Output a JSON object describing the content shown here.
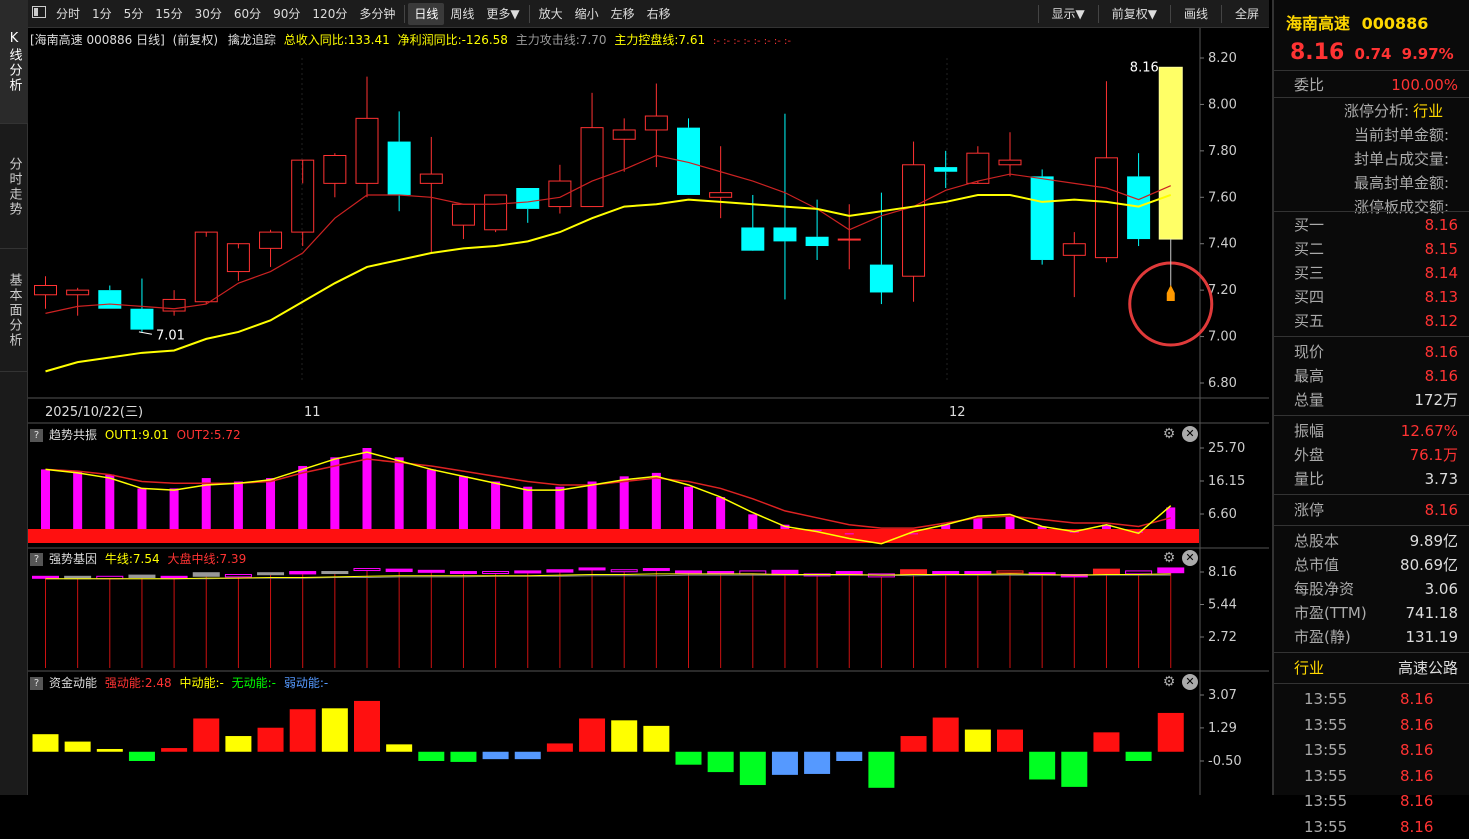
{
  "sidebar": {
    "tabs": [
      {
        "label": "K线分析"
      },
      {
        "label": "分时走势"
      },
      {
        "label": "基本面分析"
      }
    ]
  },
  "toolbar": {
    "left": [
      "分时",
      "1分",
      "5分",
      "15分",
      "30分",
      "60分",
      "90分",
      "120分",
      "多分钟",
      "日线",
      "周线",
      "更多▼",
      "放大",
      "缩小",
      "左移",
      "右移"
    ],
    "selected": "日线",
    "right": [
      "显示▼",
      "前复权▼",
      "画线",
      "全屏"
    ]
  },
  "main": {
    "legend_title": "[海南高速 000886 日线]",
    "legend_adj": "(前复权)",
    "legend_ind": "擒龙追踪",
    "legend_income": "总收入同比:133.41",
    "legend_profit": "净利润同比:-126.58",
    "legend_attack": "主力攻击线:7.70",
    "legend_control": "主力控盘线:7.61",
    "legend_dots": ":- :- :- :- :- :- :- :- ",
    "price_label": "8.16",
    "low_label": "7.01",
    "date_label": "2025/10/22(三)",
    "month_labels": [
      "11",
      "12"
    ],
    "yticks": [
      "8.20",
      "8.00",
      "7.80",
      "7.60",
      "7.40",
      "7.20",
      "7.00",
      "6.80"
    ]
  },
  "panels": [
    {
      "title": "趋势共振",
      "a": "OUT1:9.01",
      "b": "OUT2:5.72",
      "c": "",
      "d": "",
      "yticks": [
        "25.70",
        "16.15",
        "6.60"
      ]
    },
    {
      "title": "强势基因",
      "a": "牛线:7.54",
      "b": "大盘中线:7.39",
      "c": "",
      "d": "",
      "yticks": [
        "8.16",
        "5.44",
        "2.72"
      ]
    },
    {
      "title": "资金动能",
      "a": "强动能:2.48",
      "b": "中动能:-",
      "c": "无动能:-",
      "d": "弱动能:-",
      "yticks": [
        "3.07",
        "1.29",
        "-0.50"
      ]
    }
  ],
  "colors": {
    "up": "#ff3232",
    "down": "#00ffff",
    "ma1": "#ffff00",
    "ma2": "#cc2222",
    "magenta": "#ff00ff"
  },
  "chart_data": {
    "type": "candlestick",
    "candles": [
      [
        7.18,
        7.26,
        7.12,
        7.22
      ],
      [
        7.18,
        7.21,
        7.09,
        7.2
      ],
      [
        7.2,
        7.22,
        7.12,
        7.12
      ],
      [
        7.12,
        7.25,
        7.02,
        7.03
      ],
      [
        7.11,
        7.2,
        7.09,
        7.16
      ],
      [
        7.15,
        7.43,
        7.14,
        7.45
      ],
      [
        7.28,
        7.38,
        7.24,
        7.4
      ],
      [
        7.38,
        7.46,
        7.3,
        7.45
      ],
      [
        7.45,
        7.66,
        7.39,
        7.76
      ],
      [
        7.66,
        7.79,
        7.6,
        7.78
      ],
      [
        7.66,
        8.12,
        7.6,
        7.94
      ],
      [
        7.84,
        7.97,
        7.54,
        7.61
      ],
      [
        7.66,
        7.86,
        7.36,
        7.7
      ],
      [
        7.48,
        7.57,
        7.42,
        7.57
      ],
      [
        7.46,
        7.61,
        7.45,
        7.61
      ],
      [
        7.64,
        7.6,
        7.49,
        7.55
      ],
      [
        7.56,
        7.74,
        7.53,
        7.67
      ],
      [
        7.56,
        8.05,
        7.56,
        7.9
      ],
      [
        7.85,
        7.94,
        7.71,
        7.89
      ],
      [
        7.89,
        8.09,
        7.73,
        7.95
      ],
      [
        7.9,
        7.94,
        7.63,
        7.61
      ],
      [
        7.6,
        7.82,
        7.51,
        7.62
      ],
      [
        7.47,
        7.61,
        7.43,
        7.37
      ],
      [
        7.47,
        7.96,
        7.16,
        7.41
      ],
      [
        7.43,
        7.59,
        7.33,
        7.39
      ],
      [
        7.42,
        7.57,
        7.29,
        7.42
      ],
      [
        7.31,
        7.62,
        7.14,
        7.19
      ],
      [
        7.26,
        7.84,
        7.15,
        7.74
      ],
      [
        7.73,
        7.8,
        7.64,
        7.71
      ],
      [
        7.66,
        7.82,
        7.67,
        7.79
      ],
      [
        7.74,
        7.88,
        7.69,
        7.76
      ],
      [
        7.69,
        7.72,
        7.31,
        7.33
      ],
      [
        7.35,
        7.45,
        7.17,
        7.4
      ],
      [
        7.34,
        8.1,
        7.32,
        7.77
      ],
      [
        7.69,
        7.79,
        7.39,
        7.42
      ],
      [
        7.42,
        8.16,
        7.42,
        8.16
      ]
    ],
    "ma_yellow": [
      6.85,
      6.89,
      6.91,
      6.93,
      6.94,
      6.99,
      7.02,
      7.07,
      7.15,
      7.23,
      7.3,
      7.33,
      7.36,
      7.38,
      7.39,
      7.41,
      7.45,
      7.51,
      7.56,
      7.57,
      7.59,
      7.58,
      7.57,
      7.56,
      7.55,
      7.52,
      7.54,
      7.56,
      7.58,
      7.61,
      7.61,
      7.58,
      7.59,
      7.58,
      7.56,
      7.61
    ],
    "ma_red": [
      7.1,
      7.13,
      7.14,
      7.13,
      7.12,
      7.14,
      7.23,
      7.28,
      7.36,
      7.51,
      7.61,
      7.61,
      7.6,
      7.57,
      7.57,
      7.58,
      7.6,
      7.67,
      7.72,
      7.78,
      7.75,
      7.71,
      7.67,
      7.62,
      7.55,
      7.46,
      7.52,
      7.56,
      7.63,
      7.67,
      7.7,
      7.68,
      7.66,
      7.64,
      7.59,
      7.65
    ],
    "trend": {
      "bars": [
        19.5,
        19,
        18,
        14,
        14,
        17,
        16,
        17,
        20.5,
        23,
        25.7,
        23,
        19.5,
        17.5,
        16,
        14.5,
        14.5,
        16,
        17.5,
        18.5,
        14.5,
        11.5,
        6.5,
        3.5,
        2,
        1,
        0,
        1,
        3.5,
        5.5,
        6,
        3,
        1.5,
        3.5,
        1.5,
        8.5
      ],
      "l1": [
        19.5,
        18.5,
        17,
        14,
        13.5,
        15,
        15.5,
        16.5,
        19.5,
        22.5,
        24.5,
        22,
        19.5,
        17.5,
        15.5,
        13.5,
        13.5,
        15,
        16.5,
        17.5,
        15,
        11.5,
        7,
        3,
        1.5,
        -0.5,
        -2,
        1.5,
        3.5,
        6,
        6.5,
        3,
        1.5,
        3.5,
        1,
        9
      ],
      "l2": [
        19.5,
        19,
        18,
        16,
        15.5,
        15.5,
        15.5,
        16,
        18.5,
        20.5,
        22.5,
        21.5,
        20.5,
        19,
        17.5,
        16,
        15,
        15,
        16,
        17,
        16,
        14,
        11,
        7.5,
        5.5,
        3.5,
        2.5,
        2.5,
        4,
        5.5,
        6,
        5,
        4,
        4,
        3,
        5.5
      ]
    },
    "strength": {
      "bars": [
        [
          7.8,
          7.7
        ],
        [
          7.8,
          7.6
        ],
        [
          7.8,
          7.6
        ],
        [
          7.9,
          7.7
        ],
        [
          7.8,
          7.7
        ],
        [
          8.1,
          7.8
        ],
        [
          7.95,
          7.75
        ],
        [
          8.1,
          7.95
        ],
        [
          8.2,
          8.0
        ],
        [
          8.2,
          8.05
        ],
        [
          8.45,
          8.3
        ],
        [
          8.4,
          8.2
        ],
        [
          8.3,
          8.15
        ],
        [
          8.2,
          8.1
        ],
        [
          8.2,
          8.05
        ],
        [
          8.25,
          8.1
        ],
        [
          8.35,
          8.15
        ],
        [
          8.5,
          8.35
        ],
        [
          8.35,
          8.2
        ],
        [
          8.45,
          8.3
        ],
        [
          8.25,
          8.1
        ],
        [
          8.2,
          8.05
        ],
        [
          8.25,
          8.0
        ],
        [
          8.3,
          7.9
        ],
        [
          8.0,
          7.85
        ],
        [
          8.2,
          7.9
        ],
        [
          8.0,
          7.75
        ],
        [
          8.35,
          8.0
        ],
        [
          8.2,
          8.05
        ],
        [
          8.2,
          8.1
        ],
        [
          8.25,
          8.1
        ],
        [
          8.1,
          7.9
        ],
        [
          7.95,
          7.75
        ],
        [
          8.4,
          8.0
        ],
        [
          8.25,
          8.0
        ],
        [
          8.5,
          8.1
        ]
      ],
      "l1": [
        7.6,
        7.6,
        7.6,
        7.6,
        7.6,
        7.65,
        7.65,
        7.7,
        7.7,
        7.75,
        7.8,
        7.85,
        7.85,
        7.85,
        7.85,
        7.85,
        7.9,
        7.95,
        7.95,
        8.0,
        8.0,
        8.0,
        8.0,
        7.95,
        7.95,
        7.95,
        7.9,
        7.95,
        7.95,
        7.95,
        8.0,
        7.95,
        7.9,
        7.95,
        7.95,
        8.0
      ],
      "l2": [
        7.6,
        7.6,
        7.6,
        7.6,
        7.6,
        7.6,
        7.65,
        7.65,
        7.65,
        7.7,
        7.7,
        7.75,
        7.75,
        7.75,
        7.8,
        7.8,
        7.8,
        7.85,
        7.85,
        7.85,
        7.9,
        7.9,
        7.9,
        7.9,
        7.9,
        7.9,
        7.9,
        7.85,
        7.9,
        7.9,
        7.9,
        7.9,
        7.9,
        7.9,
        7.9,
        7.9
      ]
    },
    "fund": [
      0.95,
      0.55,
      0.15,
      -0.5,
      0.2,
      1.8,
      0.85,
      1.3,
      2.3,
      2.35,
      2.75,
      0.4,
      -0.5,
      -0.55,
      -0.4,
      -0.4,
      0.45,
      1.8,
      1.7,
      1.4,
      -0.7,
      -1.1,
      -1.8,
      -1.25,
      -1.2,
      -0.5,
      -1.95,
      0.85,
      1.85,
      1.2,
      1.2,
      -1.5,
      -1.9,
      1.05,
      -0.5,
      2.1
    ],
    "fund_colors": [
      "y",
      "y",
      "y",
      "g",
      "r",
      "r",
      "y",
      "r",
      "r",
      "y",
      "r",
      "y",
      "g",
      "g",
      "b",
      "b",
      "r",
      "r",
      "y",
      "y",
      "g",
      "g",
      "g",
      "b",
      "b",
      "b",
      "g",
      "r",
      "r",
      "y",
      "r",
      "g",
      "g",
      "r",
      "g",
      "r"
    ]
  },
  "stock": {
    "name": "海南高速",
    "code": "000886",
    "price": "8.16",
    "change": "0.74",
    "pct": "9.97%"
  },
  "quote": {
    "webi_l": "委比",
    "webi_v": "100.00%",
    "limit_title": "涨停分析:",
    "limit_industry": "行业",
    "limit_items": [
      "当前封单金额:",
      "封单占成交量:",
      "最高封单金额:",
      "涨停板成交额:"
    ],
    "buys": [
      {
        "l": "买一",
        "v": "8.16"
      },
      {
        "l": "买二",
        "v": "8.15"
      },
      {
        "l": "买三",
        "v": "8.14"
      },
      {
        "l": "买四",
        "v": "8.13"
      },
      {
        "l": "买五",
        "v": "8.12"
      }
    ],
    "stats1": [
      {
        "l": "现价",
        "v": "8.16",
        "c": "red"
      },
      {
        "l": "最高",
        "v": "8.16",
        "c": "red"
      },
      {
        "l": "总量",
        "v": "172万",
        "c": "white"
      }
    ],
    "stats2": [
      {
        "l": "振幅",
        "v": "12.67%",
        "c": "red"
      },
      {
        "l": "外盘",
        "v": "76.1万",
        "c": "red"
      },
      {
        "l": "量比",
        "v": "3.73",
        "c": "white"
      }
    ],
    "stats3": [
      {
        "l": "涨停",
        "v": "8.16",
        "c": "red"
      }
    ],
    "stats4": [
      {
        "l": "总股本",
        "v": "9.89亿",
        "c": "white"
      },
      {
        "l": "总市值",
        "v": "80.69亿",
        "c": "white"
      },
      {
        "l": "每股净资",
        "v": "3.06",
        "c": "white"
      },
      {
        "l": "市盈(TTM)",
        "v": "741.18",
        "c": "white"
      },
      {
        "l": "市盈(静)",
        "v": "131.19",
        "c": "white"
      }
    ],
    "industry_l": "行业",
    "industry_v": "高速公路",
    "ticks": [
      {
        "t": "13:55",
        "v": "8.16"
      },
      {
        "t": "13:55",
        "v": "8.16"
      },
      {
        "t": "13:55",
        "v": "8.16"
      },
      {
        "t": "13:55",
        "v": "8.16"
      },
      {
        "t": "13:55",
        "v": "8.16"
      },
      {
        "t": "13:55",
        "v": "8.16"
      }
    ]
  }
}
